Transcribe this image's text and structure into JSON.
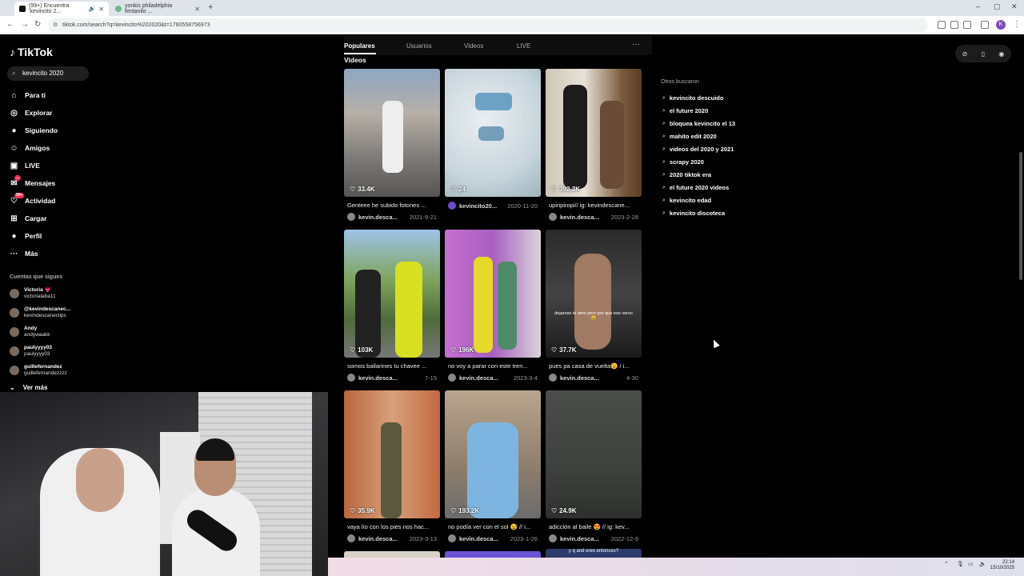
{
  "browser": {
    "tabs": [
      {
        "label": "(99+) Encuentra 'kevincito 2..."
      },
      {
        "label": "yonkis philadelphia fentanilo ..."
      }
    ],
    "url": "tiktok.com/search?q=kevincito%202020&t=1760558756973",
    "profile_initial": "K"
  },
  "sidebar": {
    "logo": "TikTok",
    "search_value": "kevincito 2020",
    "nav": [
      {
        "label": "Para ti",
        "icon": "home-icon",
        "glyph": "⌂"
      },
      {
        "label": "Explorar",
        "icon": "compass-icon",
        "glyph": "◎"
      },
      {
        "label": "Siguiendo",
        "icon": "following-icon",
        "glyph": "●"
      },
      {
        "label": "Amigos",
        "icon": "friends-icon",
        "glyph": "☺"
      },
      {
        "label": "LIVE",
        "icon": "live-icon",
        "glyph": "▣"
      },
      {
        "label": "Mensajes",
        "icon": "messages-icon",
        "glyph": "✉",
        "badge": "..."
      },
      {
        "label": "Actividad",
        "icon": "activity-icon",
        "glyph": "♡",
        "badge": "99+"
      },
      {
        "label": "Cargar",
        "icon": "upload-icon",
        "glyph": "⊞"
      },
      {
        "label": "Perfil",
        "icon": "profile-icon",
        "glyph": "●"
      },
      {
        "label": "Más",
        "icon": "more-icon",
        "glyph": "···"
      }
    ],
    "following_title": "Cuentas que sigues",
    "accounts": [
      {
        "name": "Victoria 💗",
        "handle": "victorialaba11"
      },
      {
        "name": "@kevindescanec...",
        "handle": "kevindescaneclips"
      },
      {
        "name": "Andy",
        "handle": "andywaakk"
      },
      {
        "name": "paulyyyy03",
        "handle": "paulyyyy03"
      },
      {
        "name": "guillefernandez",
        "handle": "guillefernandezzzz"
      }
    ],
    "see_more": "Ver más"
  },
  "content": {
    "tabs": [
      "Populares",
      "Usuarios",
      "Videos",
      "LIVE"
    ],
    "section_title": "Videos",
    "videos": [
      {
        "likes": "33.4K",
        "desc": "Genteee he subido fotones ...",
        "user": "kevin.desca...",
        "date": "2021-9-21"
      },
      {
        "likes": "24",
        "desc": "",
        "user": "kevincito20...",
        "date": "2020-11-20"
      },
      {
        "likes": "392.3K",
        "desc": "upiripiropi// ig: kevindescane...",
        "user": "kevin.desca...",
        "date": "2023-2-28"
      },
      {
        "likes": "103K",
        "desc": "somos bailarines tu chavee ...",
        "user": "kevin.desca...",
        "date": "7-15"
      },
      {
        "likes": "196K",
        "desc": "no voy a parar con este tren...",
        "user": "kevin.desca...",
        "date": "2023-3-4"
      },
      {
        "likes": "37.7K",
        "desc": "pues pa casa de vuelta😉 / i...",
        "user": "kevin.desca...",
        "date": "4-30",
        "overlay": "dejarose te amo pero por que ese verso😂"
      },
      {
        "likes": "35.9K",
        "desc": "vaya lío con los pies nos hac...",
        "user": "kevin.desca...",
        "date": "2023-3-13"
      },
      {
        "likes": "193.2K",
        "desc": "no podía ver con el sol 😵 // i...",
        "user": "kevin.desca...",
        "date": "2023-1-26"
      },
      {
        "likes": "24.9K",
        "desc": "adicción al baile 😍 // ig: kev...",
        "user": "kevin.desca...",
        "date": "2022-12-9"
      }
    ],
    "bottom_row_caption": "y q and eres entonces?"
  },
  "right": {
    "title": "Otros buscaron",
    "suggestions": [
      "kevincito descuido",
      "el future 2020",
      "bloquea kevincito el 13",
      "mahito edit 2020",
      "videos del 2020 y 2021",
      "scrapy 2020",
      "2020 tiktok era",
      "el future 2020 videos",
      "kevincito edad",
      "kevincito discoteca"
    ]
  },
  "taskbar": {
    "time": "22:14",
    "date": "15/10/2025"
  }
}
